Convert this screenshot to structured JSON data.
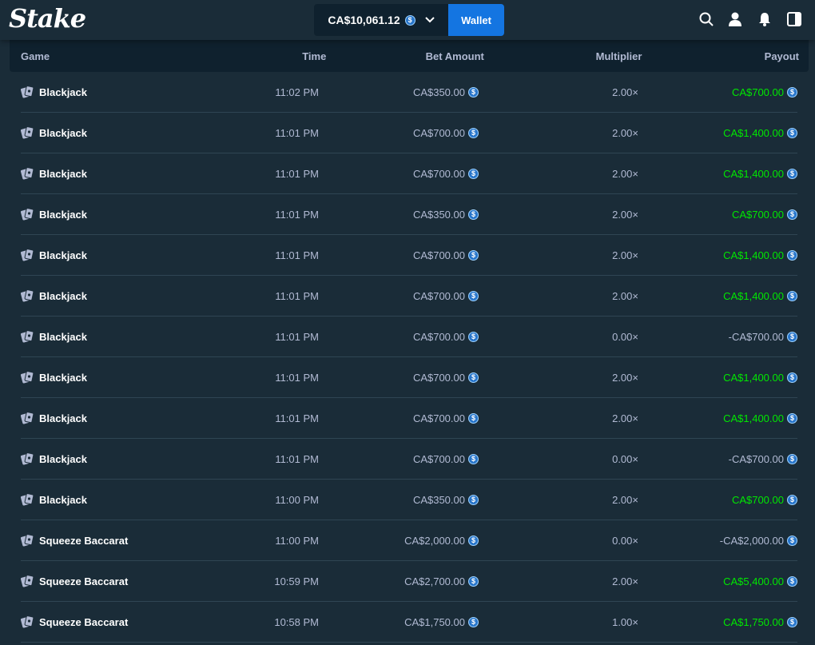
{
  "header": {
    "logo": "Stake",
    "balance": "CA$10,061.12",
    "wallet_label": "Wallet",
    "currency_icon": "usdc-coin-icon"
  },
  "colors": {
    "background": "#1a2c38",
    "header_row": "#0f212e",
    "wallet_button": "#1475e1",
    "win": "#00e701",
    "text_muted": "#b1bad3"
  },
  "table": {
    "columns": [
      "Game",
      "Time",
      "Bet Amount",
      "Multiplier",
      "Payout"
    ],
    "rows": [
      {
        "game": "Blackjack",
        "time": "11:02 PM",
        "bet": "CA$350.00",
        "mult": "2.00×",
        "payout": "CA$700.00",
        "win": true
      },
      {
        "game": "Blackjack",
        "time": "11:01 PM",
        "bet": "CA$700.00",
        "mult": "2.00×",
        "payout": "CA$1,400.00",
        "win": true
      },
      {
        "game": "Blackjack",
        "time": "11:01 PM",
        "bet": "CA$700.00",
        "mult": "2.00×",
        "payout": "CA$1,400.00",
        "win": true
      },
      {
        "game": "Blackjack",
        "time": "11:01 PM",
        "bet": "CA$350.00",
        "mult": "2.00×",
        "payout": "CA$700.00",
        "win": true
      },
      {
        "game": "Blackjack",
        "time": "11:01 PM",
        "bet": "CA$700.00",
        "mult": "2.00×",
        "payout": "CA$1,400.00",
        "win": true
      },
      {
        "game": "Blackjack",
        "time": "11:01 PM",
        "bet": "CA$700.00",
        "mult": "2.00×",
        "payout": "CA$1,400.00",
        "win": true
      },
      {
        "game": "Blackjack",
        "time": "11:01 PM",
        "bet": "CA$700.00",
        "mult": "0.00×",
        "payout": "-CA$700.00",
        "win": false
      },
      {
        "game": "Blackjack",
        "time": "11:01 PM",
        "bet": "CA$700.00",
        "mult": "2.00×",
        "payout": "CA$1,400.00",
        "win": true
      },
      {
        "game": "Blackjack",
        "time": "11:01 PM",
        "bet": "CA$700.00",
        "mult": "2.00×",
        "payout": "CA$1,400.00",
        "win": true
      },
      {
        "game": "Blackjack",
        "time": "11:01 PM",
        "bet": "CA$700.00",
        "mult": "0.00×",
        "payout": "-CA$700.00",
        "win": false
      },
      {
        "game": "Blackjack",
        "time": "11:00 PM",
        "bet": "CA$350.00",
        "mult": "2.00×",
        "payout": "CA$700.00",
        "win": true
      },
      {
        "game": "Squeeze Baccarat",
        "time": "11:00 PM",
        "bet": "CA$2,000.00",
        "mult": "0.00×",
        "payout": "-CA$2,000.00",
        "win": false
      },
      {
        "game": "Squeeze Baccarat",
        "time": "10:59 PM",
        "bet": "CA$2,700.00",
        "mult": "2.00×",
        "payout": "CA$5,400.00",
        "win": true
      },
      {
        "game": "Squeeze Baccarat",
        "time": "10:58 PM",
        "bet": "CA$1,750.00",
        "mult": "1.00×",
        "payout": "CA$1,750.00",
        "win": true
      }
    ]
  }
}
